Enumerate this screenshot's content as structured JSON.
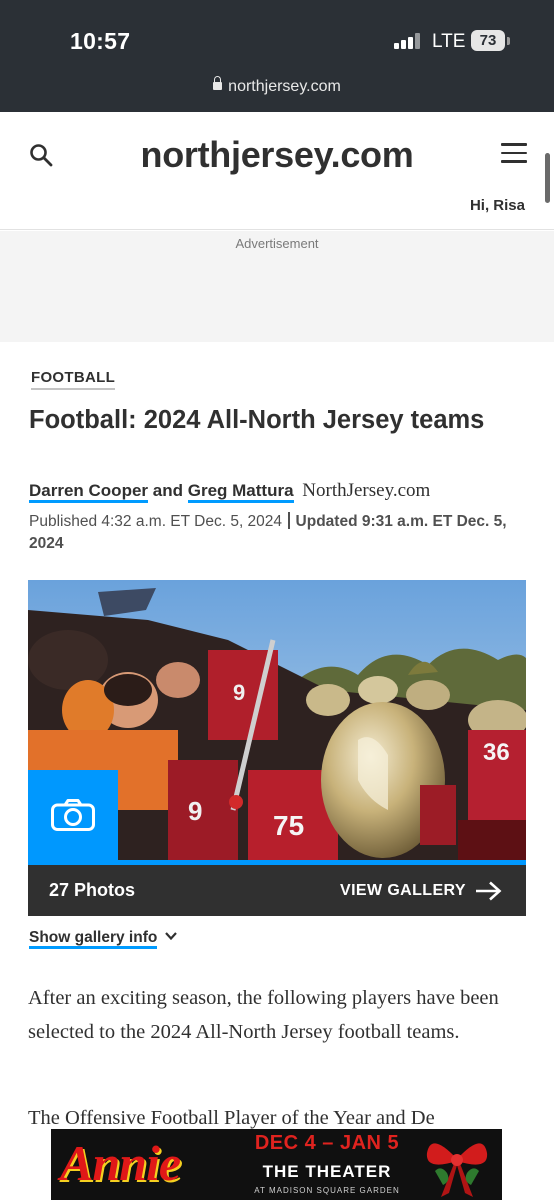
{
  "status_bar": {
    "time": "10:57",
    "network": "LTE",
    "battery": "73",
    "url": "northjersey.com"
  },
  "header": {
    "logo": "northjersey.com",
    "greeting": "Hi, Risa",
    "icons": [
      "search-icon",
      "menu-icon"
    ]
  },
  "ad": {
    "label": "Advertisement"
  },
  "article": {
    "section": "FOOTBALL",
    "headline": "Football: 2024 All-North Jersey teams",
    "authors": [
      "Darren Cooper",
      "Greg Mattura"
    ],
    "byline_joiner": "and",
    "source": "NorthJersey.com",
    "published": "Published 4:32 a.m. ET Dec. 5, 2024",
    "updated": "Updated 9:31 a.m. ET Dec. 5, 2024",
    "paragraphs": [
      "After an exciting season, the following players have been selected to the 2024 All-North Jersey football teams.",
      "The Offensive Football Player of the Year and De"
    ]
  },
  "gallery": {
    "photo_count": "27 Photos",
    "view_label": "VIEW GALLERY",
    "info_label": "Show gallery info"
  },
  "banner_ad": {
    "title": "Annie",
    "dates": "DEC 4 – JAN 5",
    "venue": "THE THEATER",
    "sub": "AT MADISON SQUARE GARDEN"
  },
  "colors": {
    "status_bar": "#2b3036",
    "accent_blue": "#0098fe",
    "text_dark": "#303030",
    "gallery_bar": "#303030"
  }
}
